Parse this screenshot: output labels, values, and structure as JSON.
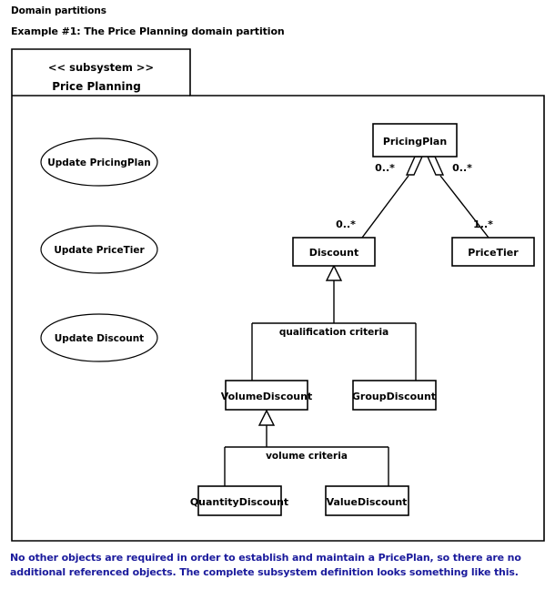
{
  "document": {
    "title": "Domain partitions",
    "example_label": "Example #1:  The Price Planning domain partition",
    "caption": "No other objects are required in order to establish and maintain a PricePlan,  so there are no additional referenced objects.  The complete subsystem definition looks something like this."
  },
  "colors": {
    "caption_text": "#1a1a9c",
    "diagram_stroke": "#000000",
    "box_fill": "#ffffff",
    "page_background": "#ffffff"
  },
  "subsystem": {
    "stereotype": "<< subsystem >>",
    "name": "Price Planning"
  },
  "use_cases": [
    {
      "label": "Update PricingPlan"
    },
    {
      "label": "Update  PriceTier"
    },
    {
      "label": "Update Discount"
    }
  ],
  "classes": [
    {
      "id": "pricingplan",
      "label": "PricingPlan"
    },
    {
      "id": "discount",
      "label": "Discount"
    },
    {
      "id": "pricetier",
      "label": "PriceTier"
    },
    {
      "id": "volumediscount",
      "label": "VolumeDiscount"
    },
    {
      "id": "groupdiscount",
      "label": "GroupDiscount"
    },
    {
      "id": "quantitydiscount",
      "label": "QuantityDiscount"
    },
    {
      "id": "valuediscount",
      "label": "ValueDiscount"
    }
  ],
  "associations": [
    {
      "from": "pricingplan",
      "to": "discount",
      "type": "aggregation",
      "source_multiplicity": "0..*",
      "target_multiplicity": "0..*"
    },
    {
      "from": "pricingplan",
      "to": "pricetier",
      "type": "aggregation",
      "source_multiplicity": "0..*",
      "target_multiplicity": "1..*"
    }
  ],
  "generalizations": [
    {
      "superclass": "discount",
      "discriminator": "qualification criteria",
      "subclasses": [
        "volumediscount",
        "groupdiscount"
      ]
    },
    {
      "superclass": "volumediscount",
      "discriminator": "volume criteria",
      "subclasses": [
        "quantitydiscount",
        "valuediscount"
      ]
    }
  ]
}
